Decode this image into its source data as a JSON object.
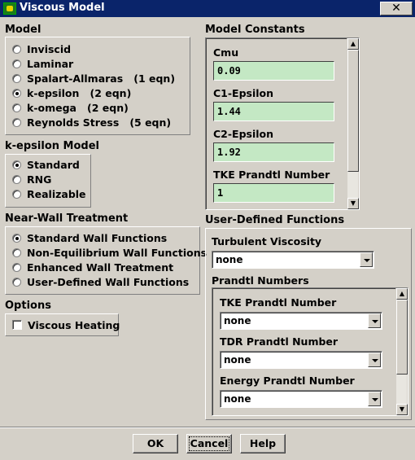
{
  "window": {
    "title": "Viscous Model",
    "close_label": "✕"
  },
  "model": {
    "title": "Model",
    "options": [
      {
        "label": "Inviscid",
        "selected": false
      },
      {
        "label": "Laminar",
        "selected": false
      },
      {
        "label": "Spalart-Allmaras   (1 eqn)",
        "selected": false
      },
      {
        "label": "k-epsilon   (2 eqn)",
        "selected": true
      },
      {
        "label": "k-omega   (2 eqn)",
        "selected": false
      },
      {
        "label": "Reynolds Stress   (5 eqn)",
        "selected": false
      }
    ]
  },
  "kepsilon_model": {
    "title": "k-epsilon Model",
    "options": [
      {
        "label": "Standard",
        "selected": true
      },
      {
        "label": "RNG",
        "selected": false
      },
      {
        "label": "Realizable",
        "selected": false
      }
    ]
  },
  "near_wall": {
    "title": "Near-Wall Treatment",
    "options": [
      {
        "label": "Standard Wall Functions",
        "selected": true
      },
      {
        "label": "Non-Equilibrium Wall Functions",
        "selected": false
      },
      {
        "label": "Enhanced Wall Treatment",
        "selected": false
      },
      {
        "label": "User-Defined Wall Functions",
        "selected": false
      }
    ]
  },
  "options": {
    "title": "Options",
    "viscous_heating_label": "Viscous Heating",
    "viscous_heating_checked": false
  },
  "constants": {
    "title": "Model Constants",
    "items": [
      {
        "label": "Cmu",
        "value": "0.09"
      },
      {
        "label": "C1-Epsilon",
        "value": "1.44"
      },
      {
        "label": "C2-Epsilon",
        "value": "1.92"
      },
      {
        "label": "TKE Prandtl Number",
        "value": "1"
      }
    ]
  },
  "udf": {
    "title": "User-Defined Functions",
    "turbulent_viscosity_label": "Turbulent Viscosity",
    "turbulent_viscosity_value": "none",
    "prandtl_title": "Prandtl Numbers",
    "prandtl": [
      {
        "label": "TKE Prandtl Number",
        "value": "none"
      },
      {
        "label": "TDR Prandtl Number",
        "value": "none"
      },
      {
        "label": "Energy Prandtl Number",
        "value": "none"
      }
    ]
  },
  "buttons": {
    "ok": "OK",
    "cancel": "Cancel",
    "help": "Help"
  },
  "colors": {
    "titlebar": "#0a246a",
    "field_bg": "#c4e8c4",
    "dialog_bg": "#d4d0c8"
  }
}
